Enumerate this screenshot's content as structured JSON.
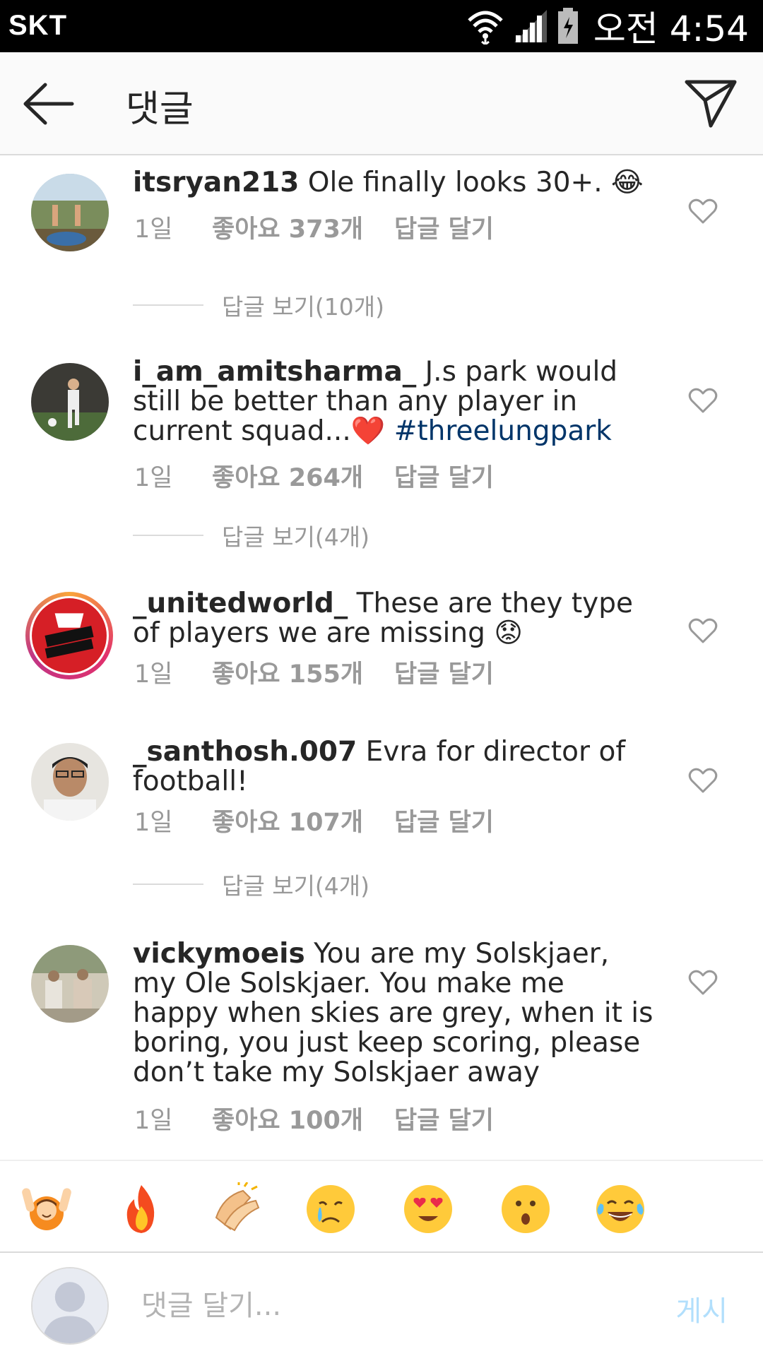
{
  "status_bar": {
    "carrier": "SKT",
    "time": "오전 4:54",
    "icons": [
      "wifi-icon",
      "signal-icon",
      "battery-icon"
    ]
  },
  "header": {
    "title": "댓글",
    "back_icon": "arrow-left-icon",
    "send_icon": "paper-plane-icon"
  },
  "comments": [
    {
      "username": "itsryan213",
      "text": " Ole finally looks 30+. 😂",
      "age": "1일",
      "likes": "좋아요 373개",
      "reply": "답글 달기",
      "view_replies": "답글 보기(10개)"
    },
    {
      "username": "i_am_amitsharma_",
      "text": " J.s park would still be better than any player in current squad...❤️ ",
      "hashtag": "#threelungpark",
      "age": "1일",
      "likes": "좋아요 264개",
      "reply": "답글 달기",
      "view_replies": "답글 보기(4개)"
    },
    {
      "username": "_unitedworld_",
      "text": " These are they type of players we are missing 😟",
      "age": "1일",
      "likes": "좋아요 155개",
      "reply": "답글 달기"
    },
    {
      "username": "_santhosh.007",
      "text": " Evra for director of football!",
      "age": "1일",
      "likes": "좋아요 107개",
      "reply": "답글 달기",
      "view_replies": "답글 보기(4개)"
    },
    {
      "username": "vickymoeis",
      "text": " You are my Solskjaer, my Ole Solskjaer. You make me happy when skies are grey, when it is boring, you just keep scoring, please don’t take my Solskjaer away",
      "age": "1일",
      "likes": "좋아요 100개",
      "reply": "답글 달기"
    }
  ],
  "emoji_bar": [
    "raising-hands-emoji",
    "fire-emoji",
    "clapping-emoji",
    "crying-emoji",
    "heart-eyes-emoji",
    "surprised-emoji",
    "tears-of-joy-emoji"
  ],
  "input": {
    "placeholder": "댓글 달기...",
    "post_label": "게시"
  },
  "colors": {
    "username": "#262626",
    "meta": "#999999",
    "hashtag": "#003569",
    "post_disabled": "#b2dffc",
    "header_bg": "#fafafa"
  }
}
